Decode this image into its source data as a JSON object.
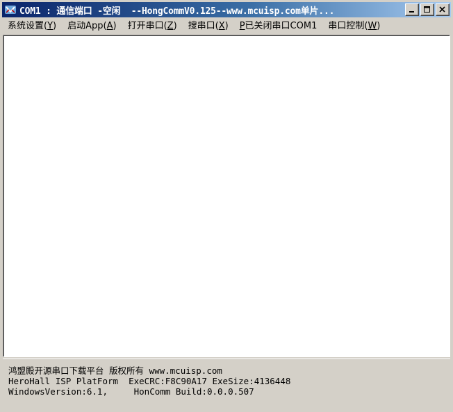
{
  "window": {
    "title": "COM1 : 通信端口 -空闲  --HongCommV0.125--www.mcuisp.com单片...",
    "app_icon": "hongcomm-app-icon",
    "caption_buttons": [
      "minimize",
      "maximize",
      "close"
    ]
  },
  "menu": {
    "items": [
      {
        "label": "系统设置(",
        "key": "Y",
        "suffix": ")"
      },
      {
        "label": "启动App(",
        "key": "A",
        "suffix": ")"
      },
      {
        "label": "打开串口(",
        "key": "Z",
        "suffix": ")"
      },
      {
        "label": "搜串口(",
        "key": "X",
        "suffix": ")"
      },
      {
        "label": "",
        "key": "P",
        "suffix": "已关闭串口COM1"
      },
      {
        "label": "串口控制(",
        "key": "W",
        "suffix": ")"
      }
    ]
  },
  "status": {
    "lines": [
      "鸿盟殿开源串口下载平台 版权所有 www.mcuisp.com",
      "HeroHall ISP PlatForm  ExeCRC:F8C90A17 ExeSize:4136448",
      "WindowsVersion:6.1,     HonComm Build:0.0.0.507"
    ]
  },
  "colors": {
    "titlebar_start": "#0a246a",
    "titlebar_end": "#a6caf0",
    "face": "#d4d0c8",
    "content_bg": "#ffffff"
  }
}
